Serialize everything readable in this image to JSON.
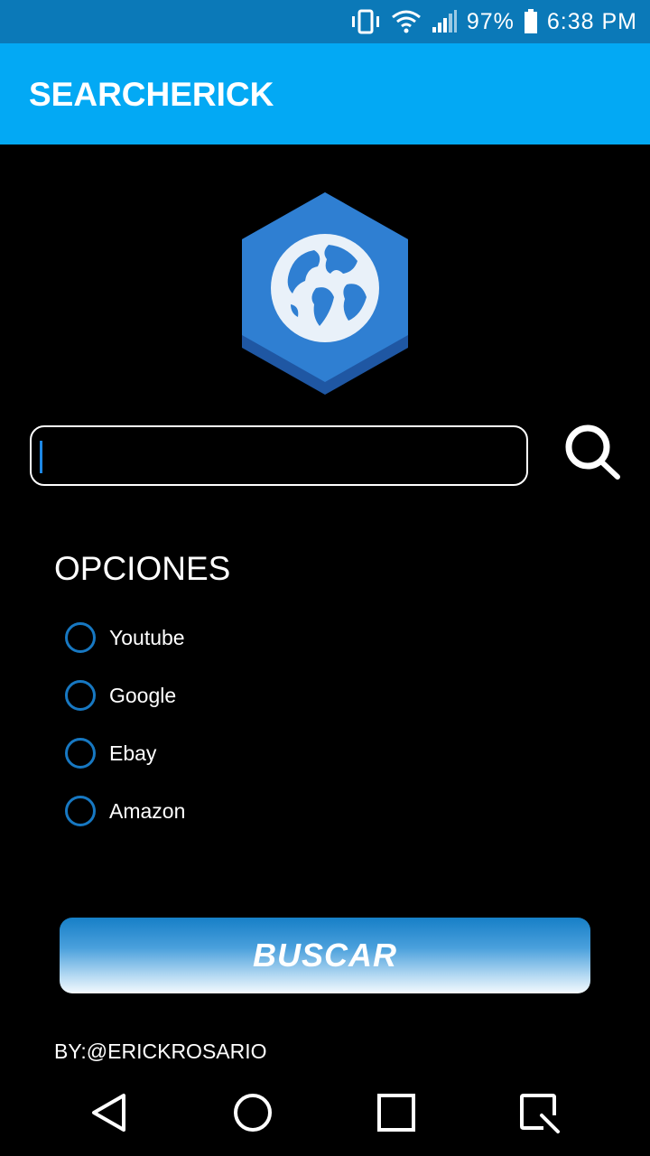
{
  "status_bar": {
    "battery": "97%",
    "time": "6:38 PM",
    "icons": [
      "vibrate-icon",
      "wifi-icon",
      "signal-icon",
      "battery-icon"
    ]
  },
  "app_bar": {
    "title": "SEARCHERICK"
  },
  "logo": {
    "icon": "globe-icon",
    "colors": {
      "face": "#2f7fd2",
      "side": "#1f57a3"
    }
  },
  "search": {
    "value": "",
    "placeholder": "",
    "button_icon": "search-icon"
  },
  "options": {
    "title": "OPCIONES",
    "items": [
      {
        "label": "Youtube",
        "selected": false
      },
      {
        "label": "Google",
        "selected": false
      },
      {
        "label": "Ebay",
        "selected": false
      },
      {
        "label": "Amazon",
        "selected": false
      }
    ]
  },
  "buscar_button": {
    "label": "BUSCAR"
  },
  "credit": "BY:@ERICKROSARIO",
  "nav_bar": {
    "icons": [
      "back-icon",
      "home-icon",
      "recents-icon",
      "screenshot-icon"
    ]
  },
  "colors": {
    "app_bar": "#03a9f4",
    "status_bar": "#0b79b8",
    "accent": "#1778c2",
    "background": "#000000"
  }
}
